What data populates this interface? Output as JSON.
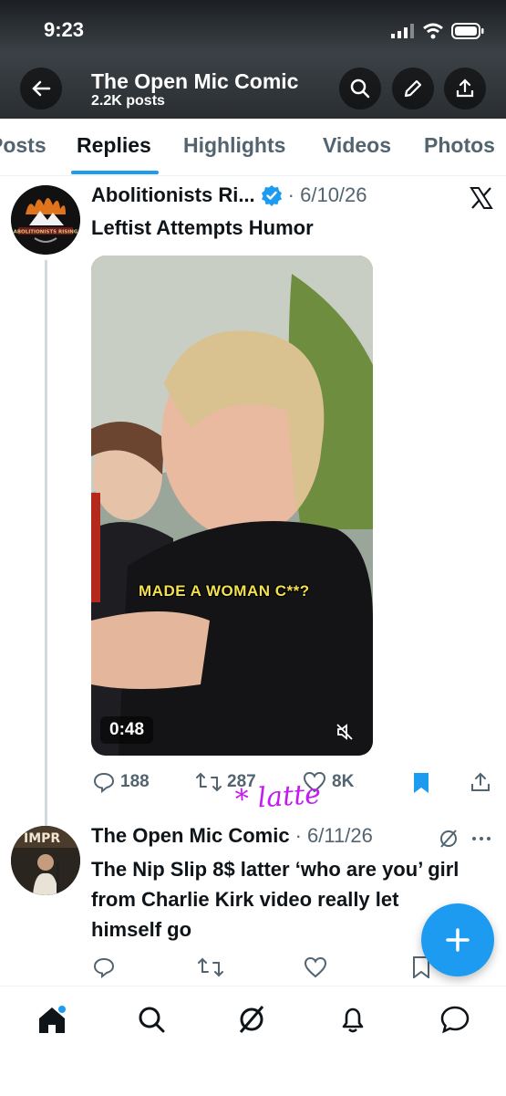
{
  "status_bar": {
    "time": "9:23"
  },
  "header": {
    "title": "The Open Mic Comic",
    "subtitle": "2.2K posts"
  },
  "tabs": [
    {
      "label": "Posts"
    },
    {
      "label": "Replies"
    },
    {
      "label": "Highlights"
    },
    {
      "label": "Videos"
    },
    {
      "label": "Photos"
    }
  ],
  "active_tab": "Replies",
  "tweet1": {
    "author": "Abolitionists Ri...",
    "date": "· 6/10/26",
    "text": "Leftist Attempts Humor",
    "avatar_text": "ABOLITIONISTS RISING",
    "video": {
      "caption": "MADE A WOMAN C**?",
      "duration": "0:48"
    },
    "actions": {
      "replies": "188",
      "reposts": "287",
      "likes": "8K"
    }
  },
  "annotation": {
    "text": "* latte"
  },
  "tweet2": {
    "author": "The Open Mic Comic",
    "date": "· 6/11/26",
    "avatar_text": "IMPR",
    "text": "The Nip Slip 8$ latter ‘who are you’ girl from Charlie Kirk video really let himself go"
  },
  "colors": {
    "accent": "#1d9bf0",
    "annotation": "#c21cf0",
    "verified": "#1d9bf0"
  },
  "bottom_nav": [
    "home-icon",
    "search-icon",
    "grok-icon",
    "notifications-icon",
    "messages-icon"
  ]
}
